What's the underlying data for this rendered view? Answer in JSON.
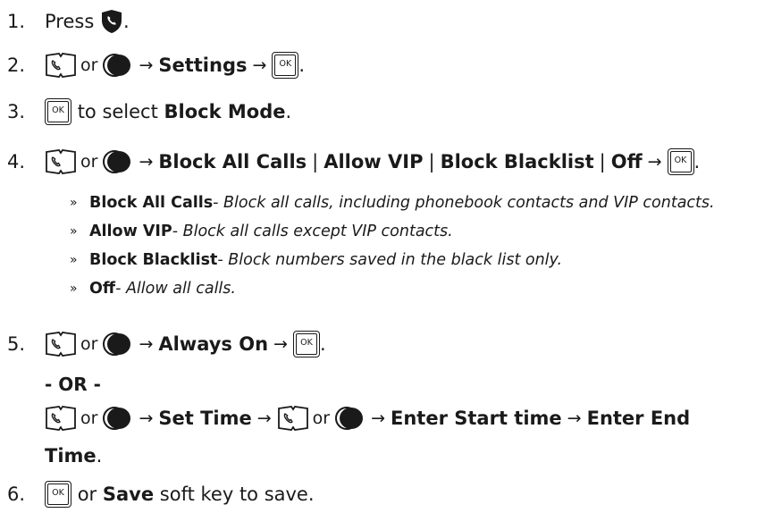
{
  "steps": [
    {
      "num": "1.",
      "text_before": "Press",
      "text_after": "."
    },
    {
      "num": "2.",
      "or": "or",
      "arrow": "→",
      "settings": "Settings",
      "end": "."
    },
    {
      "num": "3.",
      "text": "to select",
      "bold": "Block Mode",
      "end": "."
    },
    {
      "num": "4.",
      "or": "or",
      "arrow": "→",
      "opt1": "Block All Calls",
      "opt2": "Allow VIP",
      "opt3": "Block Blacklist",
      "opt4": "Off",
      "bar": "|",
      "end": "."
    },
    {
      "num": "5.",
      "or": "or",
      "arrow": "→",
      "always_on": "Always On",
      "end": ".",
      "or_divider": "- OR -",
      "set_time": "Set Time",
      "enter_start": "Enter Start time",
      "enter_end_a": "Enter End",
      "enter_end_b": "Time",
      "end2": "."
    },
    {
      "num": "6.",
      "text": "or",
      "bold": "Save",
      "rest": "soft key to save."
    }
  ],
  "sub_bullets": [
    {
      "bullet": "»",
      "term": "Block All Calls",
      "desc": " - Block all calls, including phonebook contacts and VIP contacts."
    },
    {
      "bullet": "»",
      "term": "Allow VIP",
      "desc": " - Block all calls except VIP contacts."
    },
    {
      "bullet": "»",
      "term": "Block Blacklist",
      "desc": " - Block numbers saved in the black list only."
    },
    {
      "bullet": "»",
      "term": "Off",
      "desc": " - Allow all calls."
    }
  ],
  "ok_key_label": "OK",
  "icons": [
    "phone-shield-icon",
    "phonebook-icon",
    "nav-key-icon",
    "ok-key-icon"
  ]
}
